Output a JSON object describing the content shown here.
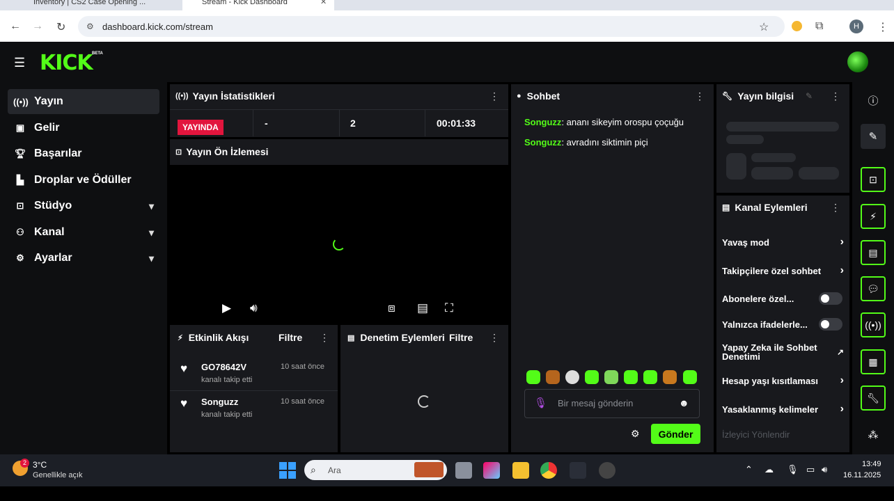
{
  "browser": {
    "tabs": [
      {
        "label": "Inventory | CS2 Case Opening ..."
      },
      {
        "label": "Stream - Kick Dashboard"
      }
    ],
    "url": "dashboard.kick.com/stream",
    "profile_initial": "H"
  },
  "header": {
    "logo": "KICK",
    "badge": "BETA"
  },
  "sidebar": {
    "items": [
      {
        "label": "Yayın",
        "icon": "broadcast-icon",
        "active": true
      },
      {
        "label": "Gelir",
        "icon": "revenue-icon"
      },
      {
        "label": "Başarılar",
        "icon": "trophy-icon"
      },
      {
        "label": "Droplar ve Ödüller",
        "icon": "gift-icon"
      },
      {
        "label": "Stüdyo",
        "icon": "studio-icon",
        "expandable": true
      },
      {
        "label": "Kanal",
        "icon": "channel-icon",
        "expandable": true
      },
      {
        "label": "Ayarlar",
        "icon": "gear-icon",
        "expandable": true
      }
    ]
  },
  "stats": {
    "title": "Yayın İstatistikleri",
    "live_badge": "YAYINDA",
    "viewers": "-",
    "followers": "2",
    "duration": "00:01:33"
  },
  "preview": {
    "title": "Yayın Ön İzlemesi"
  },
  "activity": {
    "title": "Etkinlik Akışı",
    "filter": "Filtre",
    "items": [
      {
        "user": "GO78642V",
        "action": "kanalı takip etti",
        "time": "10 saat önce"
      },
      {
        "user": "Songuzz",
        "action": "kanalı takip etti",
        "time": "10 saat önce"
      }
    ]
  },
  "moderation": {
    "title": "Denetim Eylemleri",
    "filter": "Filtre"
  },
  "chat": {
    "title": "Sohbet",
    "messages": [
      {
        "user": "Songuzz",
        "text": ": ananı sikeyim orospu çoçuğu"
      },
      {
        "user": "Songuzz",
        "text": ": avradını siktimin piçi"
      }
    ],
    "placeholder": "Bir mesaj gönderin",
    "send": "Gönder"
  },
  "stream_info": {
    "title": "Yayın bilgisi"
  },
  "channel_actions": {
    "title": "Kanal Eylemleri",
    "items": [
      {
        "label": "Yavaş mod",
        "kind": "arrow"
      },
      {
        "label": "Takipçilere özel sohbet",
        "kind": "arrow"
      },
      {
        "label": "Abonelere özel...",
        "kind": "toggle",
        "on": false
      },
      {
        "label": "Yalnızca ifadelerle...",
        "kind": "toggle",
        "on": false
      },
      {
        "label": "Yapay Zeka ile Sohbet Denetimi",
        "kind": "external"
      },
      {
        "label": "Hesap yaşı kısıtlaması",
        "kind": "arrow"
      },
      {
        "label": "Yasaklanmış kelimeler",
        "kind": "arrow"
      },
      {
        "label": "İzleyici Yönlendir",
        "kind": "disabled"
      }
    ]
  },
  "taskbar": {
    "weather_temp": "3°C",
    "weather_desc": "Genellikle açık",
    "weather_badge": "2",
    "search_placeholder": "Ara",
    "time": "13:49",
    "date": "16.11.2025"
  },
  "colors": {
    "accent": "#53fc18",
    "live": "#e2153d",
    "panel": "#18191d",
    "bg": "#0e0f11"
  }
}
